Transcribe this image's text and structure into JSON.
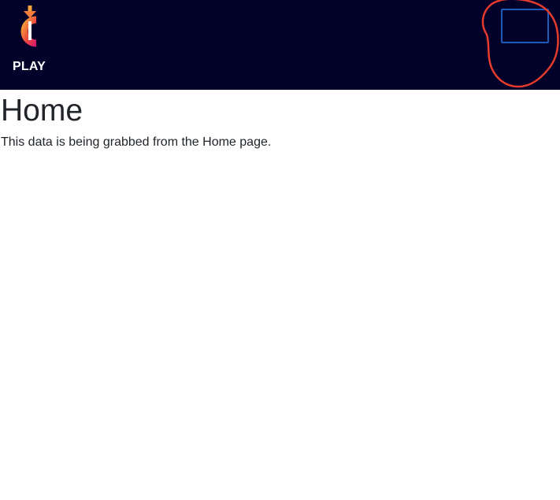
{
  "navbar": {
    "logo_icon": "brand-c-logo-icon",
    "play_label": "PLAY",
    "toggler_icon": "menu-toggle-icon",
    "annotation_color": "#e53b2c",
    "background": "#01012a"
  },
  "main": {
    "title": "Home",
    "text": "This data is being grabbed from the Home page."
  }
}
